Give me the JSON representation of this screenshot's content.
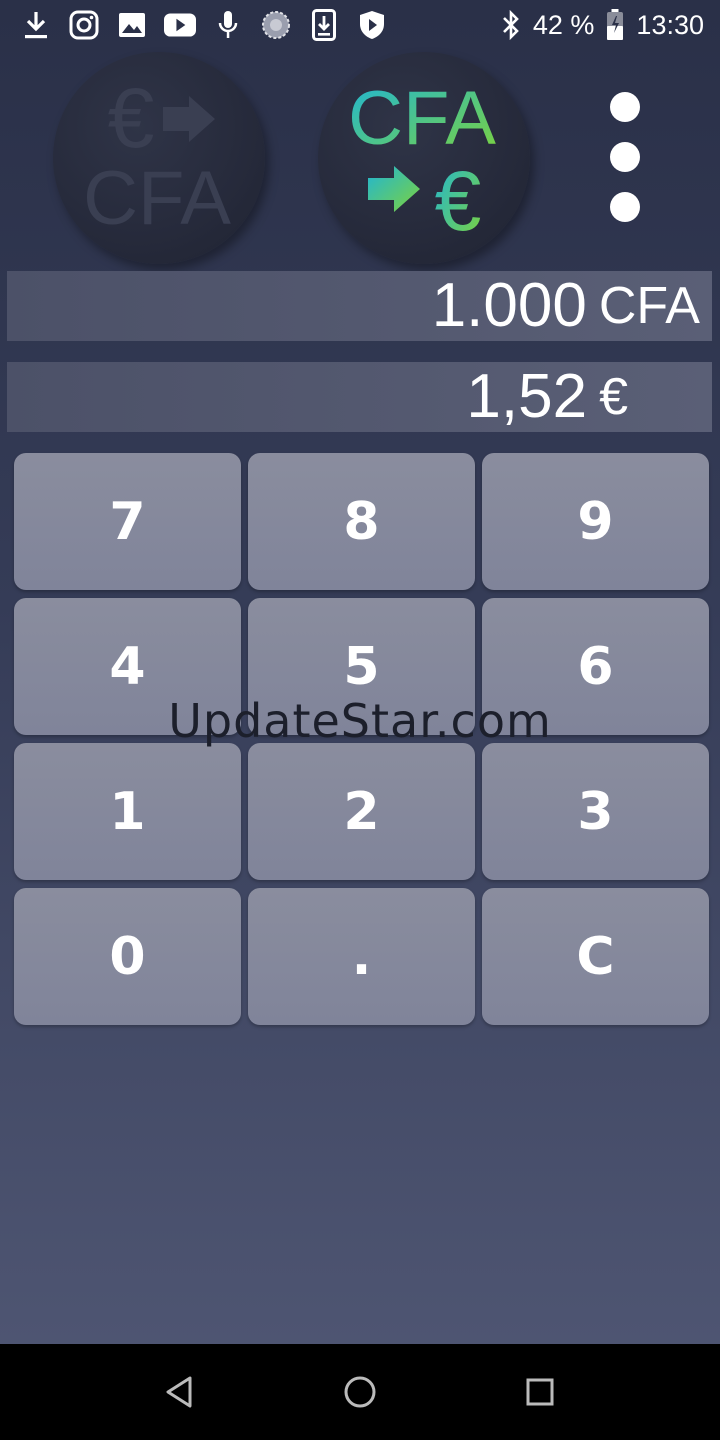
{
  "status_bar": {
    "battery_percent": "42 %",
    "time": "13:30",
    "left_icons": [
      "download-icon",
      "instagram-icon",
      "image-icon",
      "youtube-icon",
      "microphone-icon",
      "loading-icon",
      "download-box-icon",
      "shield-icon"
    ],
    "right_icons": [
      "bluetooth-icon",
      "battery-icon"
    ]
  },
  "toolbar": {
    "logo_eur_to_cfa": {
      "top": "€",
      "bottom": "CFA",
      "icon": "eur-to-cfa-icon"
    },
    "logo_cfa_to_eur": {
      "top": "CFA",
      "bottom": "€",
      "icon": "cfa-to-eur-icon"
    },
    "menu_icon": "more-vert-icon"
  },
  "displays": {
    "input": {
      "value": "1.000",
      "currency": "CFA"
    },
    "output": {
      "value": "1,52",
      "currency": "€"
    }
  },
  "keypad": {
    "keys": [
      "7",
      "8",
      "9",
      "4",
      "5",
      "6",
      "1",
      "2",
      "3",
      "0",
      ".",
      "C"
    ]
  },
  "watermark": "UpdateStar.com",
  "navigation": [
    "back-icon",
    "home-icon",
    "recents-icon"
  ],
  "colors": {
    "background_top": "#2a3048",
    "background_bottom": "#4e5572",
    "key": "#868a9c",
    "display": "#545970",
    "logo_gradient_start": "#1fb5d6",
    "logo_gradient_end": "#7ed33a"
  }
}
